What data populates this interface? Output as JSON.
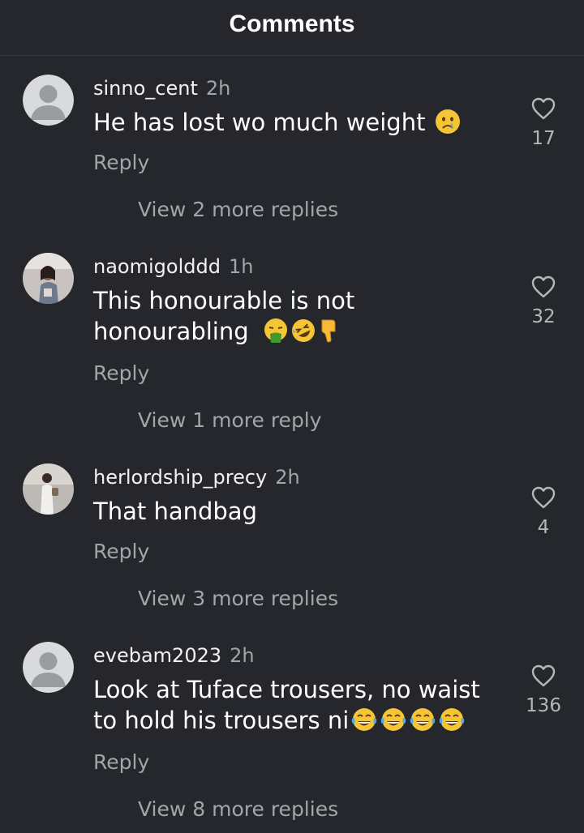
{
  "header": {
    "title": "Comments"
  },
  "comments": [
    {
      "username": "sinno_cent",
      "time": "2h",
      "text": "He has lost wo much weight",
      "emojis": [
        "crying-face"
      ],
      "reply_label": "Reply",
      "view_more": "View 2 more replies",
      "likes": "17",
      "avatar": "default-avatar"
    },
    {
      "username": "naomigolddd",
      "time": "1h",
      "text_line1": "This honourable is not",
      "text_line2": "honourabling",
      "emojis": [
        "vomiting-face",
        "rolling-laughing-face",
        "thumbs-down"
      ],
      "reply_label": "Reply",
      "view_more": "View 1 more reply",
      "likes": "32",
      "avatar": "photo-avatar"
    },
    {
      "username": "herlordship_precy",
      "time": "2h",
      "text": "That handbag",
      "reply_label": "Reply",
      "view_more": "View 3 more replies",
      "likes": "4",
      "avatar": "photo-avatar"
    },
    {
      "username": "evebam2023",
      "time": "2h",
      "text_line1": "Look at Tuface trousers, no waist",
      "text_line2": "to hold his trousers ni",
      "emojis": [
        "tears-of-joy",
        "tears-of-joy",
        "tears-of-joy",
        "tears-of-joy"
      ],
      "reply_label": "Reply",
      "view_more": "View 8 more replies",
      "likes": "136",
      "avatar": "default-avatar"
    }
  ],
  "colors": {
    "background": "#25272c",
    "text_primary": "#ffffff",
    "text_secondary": "#a3a5aa",
    "avatar_default_bg": "#d9dadc",
    "avatar_default_fg": "#9a9ca0"
  }
}
